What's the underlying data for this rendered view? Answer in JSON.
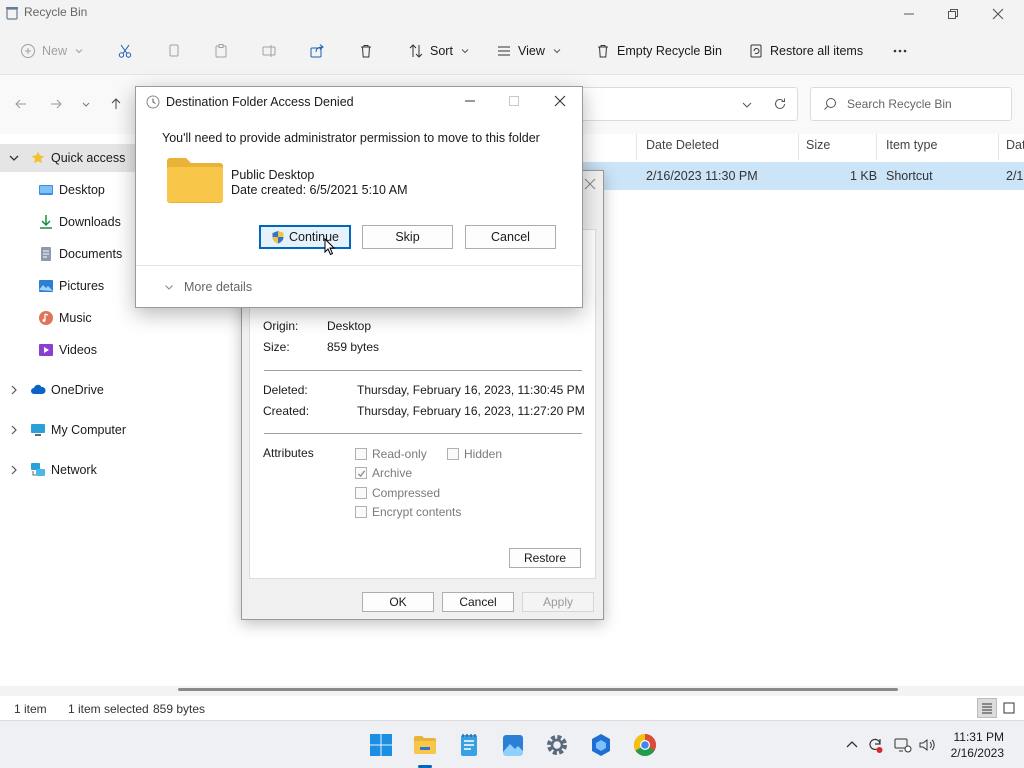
{
  "window": {
    "title": "Recycle Bin"
  },
  "toolbar": {
    "new_label": "New",
    "sort_label": "Sort",
    "view_label": "View",
    "empty_label": "Empty Recycle Bin",
    "restore_all_label": "Restore all items"
  },
  "search": {
    "placeholder": "Search Recycle Bin"
  },
  "sidebar": {
    "items": [
      {
        "label": "Quick access",
        "icon": "star-icon"
      },
      {
        "label": "Desktop",
        "icon": "desktop-icon"
      },
      {
        "label": "Downloads",
        "icon": "download-icon"
      },
      {
        "label": "Documents",
        "icon": "documents-icon"
      },
      {
        "label": "Pictures",
        "icon": "pictures-icon"
      },
      {
        "label": "Music",
        "icon": "music-icon"
      },
      {
        "label": "Videos",
        "icon": "videos-icon"
      },
      {
        "label": "OneDrive",
        "icon": "cloud-icon"
      },
      {
        "label": "My Computer",
        "icon": "computer-icon"
      },
      {
        "label": "Network",
        "icon": "network-icon"
      }
    ]
  },
  "columns": {
    "date_deleted": "Date Deleted",
    "size": "Size",
    "item_type": "Item type",
    "date_modified_partial": "Dat"
  },
  "file_row": {
    "date_deleted": "2/16/2023 11:30 PM",
    "size": "1 KB",
    "item_type": "Shortcut",
    "date_partial": "2/1"
  },
  "status": {
    "items": "1 item",
    "selected": "1 item selected",
    "bytes": "859 bytes"
  },
  "properties": {
    "origin_label": "Origin:",
    "origin_value": "Desktop",
    "size_label": "Size:",
    "size_value": "859 bytes",
    "deleted_label": "Deleted:",
    "deleted_value": "Thursday, February 16, 2023, 11:30:45 PM",
    "created_label": "Created:",
    "created_value": "Thursday, February 16, 2023, 11:27:20 PM",
    "attributes_label": "Attributes",
    "readonly_label": "Read-only",
    "hidden_label": "Hidden",
    "archive_label": "Archive",
    "compressed_label": "Compressed",
    "encrypt_label": "Encrypt contents",
    "restore_label": "Restore",
    "ok_label": "OK",
    "cancel_label": "Cancel",
    "apply_label": "Apply"
  },
  "dialog": {
    "title": "Destination Folder Access Denied",
    "message": "You'll need to provide administrator permission to move to this folder",
    "folder_name": "Public Desktop",
    "date_created": "Date created: 6/5/2021 5:10 AM",
    "continue_label": "Continue",
    "skip_label": "Skip",
    "cancel_label": "Cancel",
    "more_details_label": "More details"
  },
  "taskbar": {
    "time": "11:31 PM",
    "date": "2/16/2023"
  },
  "colors": {
    "accent": "#0067c0",
    "selection": "#cce4f7",
    "folder": "#f8c74a"
  }
}
